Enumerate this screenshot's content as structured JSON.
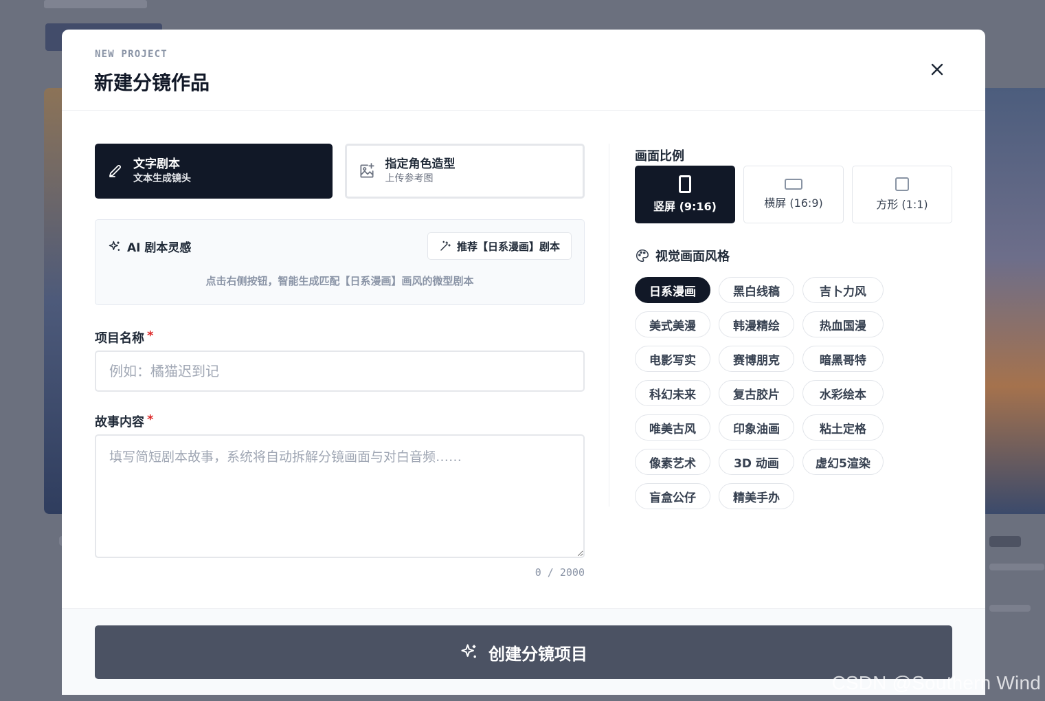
{
  "modal": {
    "eyebrow": "NEW PROJECT",
    "title": "新建分镜作品",
    "close_icon": "close-icon"
  },
  "modes": [
    {
      "title": "文字剧本",
      "subtitle": "文本生成镜头",
      "icon": "pencil-icon",
      "active": true
    },
    {
      "title": "指定角色造型",
      "subtitle": "上传参考图",
      "icon": "image-plus-icon",
      "active": false
    }
  ],
  "ai_inspiration": {
    "heading": "AI 剧本灵感",
    "button_label": "推荐【日系漫画】剧本",
    "hint": "点击右侧按钮，智能生成匹配【日系漫画】画风的微型剧本"
  },
  "fields": {
    "name_label": "项目名称",
    "name_required_mark": "*",
    "name_value": "",
    "name_placeholder": "例如：橘猫迟到记",
    "story_label": "故事内容",
    "story_required_mark": "*",
    "story_value": "",
    "story_placeholder": "填写简短剧本故事，系统将自动拆解分镜画面与对白音频……",
    "char_count": "0 / 2000"
  },
  "aspect_ratio": {
    "label": "画面比例",
    "options": [
      {
        "label": "竖屏 (9:16)",
        "icon": "portrait-icon",
        "active": true
      },
      {
        "label": "横屏 (16:9)",
        "icon": "landscape-icon",
        "active": false
      },
      {
        "label": "方形 (1:1)",
        "icon": "square-icon",
        "active": false
      }
    ]
  },
  "visual_style": {
    "label": "视觉画面风格",
    "icon": "palette-icon",
    "selected": "日系漫画",
    "options": [
      "日系漫画",
      "黑白线稿",
      "吉卜力风",
      "美式美漫",
      "韩漫精绘",
      "热血国漫",
      "电影写实",
      "赛博朋克",
      "暗黑哥特",
      "科幻未来",
      "复古胶片",
      "水彩绘本",
      "唯美古风",
      "印象油画",
      "粘土定格",
      "像素艺术",
      "3D 动画",
      "虚幻5渲染",
      "盲盒公仔",
      "精美手办"
    ]
  },
  "submit": {
    "label": "创建分镜项目",
    "icon": "sparkle-icon"
  },
  "watermark": "CSDN @Southern Wind",
  "colors": {
    "primary_dark": "#111827",
    "submit_bg": "#4b5263",
    "required": "#dc2626",
    "overlay": "#6e7280"
  }
}
